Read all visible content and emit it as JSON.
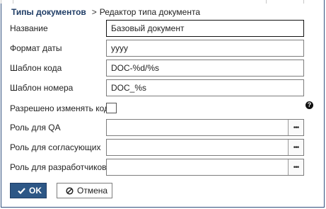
{
  "breadcrumb": {
    "root": "Типы документов",
    "separator": ">",
    "current": "Редактор типа документа"
  },
  "fields": {
    "name": {
      "label": "Название",
      "value": "Базовый документ"
    },
    "date_format": {
      "label": "Формат даты",
      "value": "yyyy"
    },
    "code_template": {
      "label": "Шаблон кода",
      "value": "DOC-%d/%s"
    },
    "number_template": {
      "label": "Шаблон номера",
      "value": "DOC_%s"
    },
    "allow_code_change": {
      "label": "Разрешено изменять код",
      "checked": false
    },
    "qa_role": {
      "label": "Роль для QA",
      "value": ""
    },
    "approvers_role": {
      "label": "Роль для согласующих",
      "value": ""
    },
    "developers_role": {
      "label": "Роль для разработчиков",
      "value": ""
    }
  },
  "lookup_button_label": "•••",
  "help_icon": "question-circle-icon",
  "buttons": {
    "ok": "OK",
    "cancel": "Отмена"
  },
  "colors": {
    "accent": "#2d5786",
    "link": "#1f3d66",
    "frame": "#2f4f7c"
  }
}
